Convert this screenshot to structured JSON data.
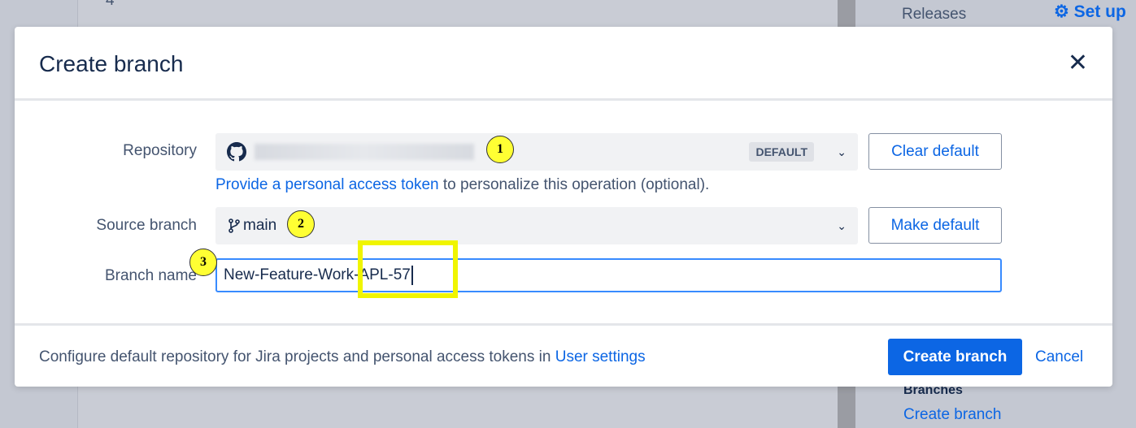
{
  "background": {
    "page_number": "4",
    "releases": "Releases",
    "setup": "Set up",
    "branches": "Branches",
    "create_branch_link": "Create branch"
  },
  "modal": {
    "title": "Create branch",
    "repository": {
      "label": "Repository",
      "badge": "DEFAULT",
      "clear_default": "Clear default",
      "token_link": "Provide a personal access token",
      "token_text": " to personalize this operation (optional)."
    },
    "source_branch": {
      "label": "Source branch",
      "value": "main",
      "make_default": "Make default"
    },
    "branch_name": {
      "label": "Branch name",
      "value": "New-Feature-Work-APL-57"
    },
    "footer": {
      "text": "Configure default repository for Jira projects and personal access tokens in ",
      "link": "User settings",
      "create": "Create branch",
      "cancel": "Cancel"
    }
  },
  "annotations": [
    "1",
    "2",
    "3"
  ],
  "colors": {
    "primary": "#0c66e4",
    "annotation": "#ffff33",
    "highlight": "#f0f500"
  }
}
